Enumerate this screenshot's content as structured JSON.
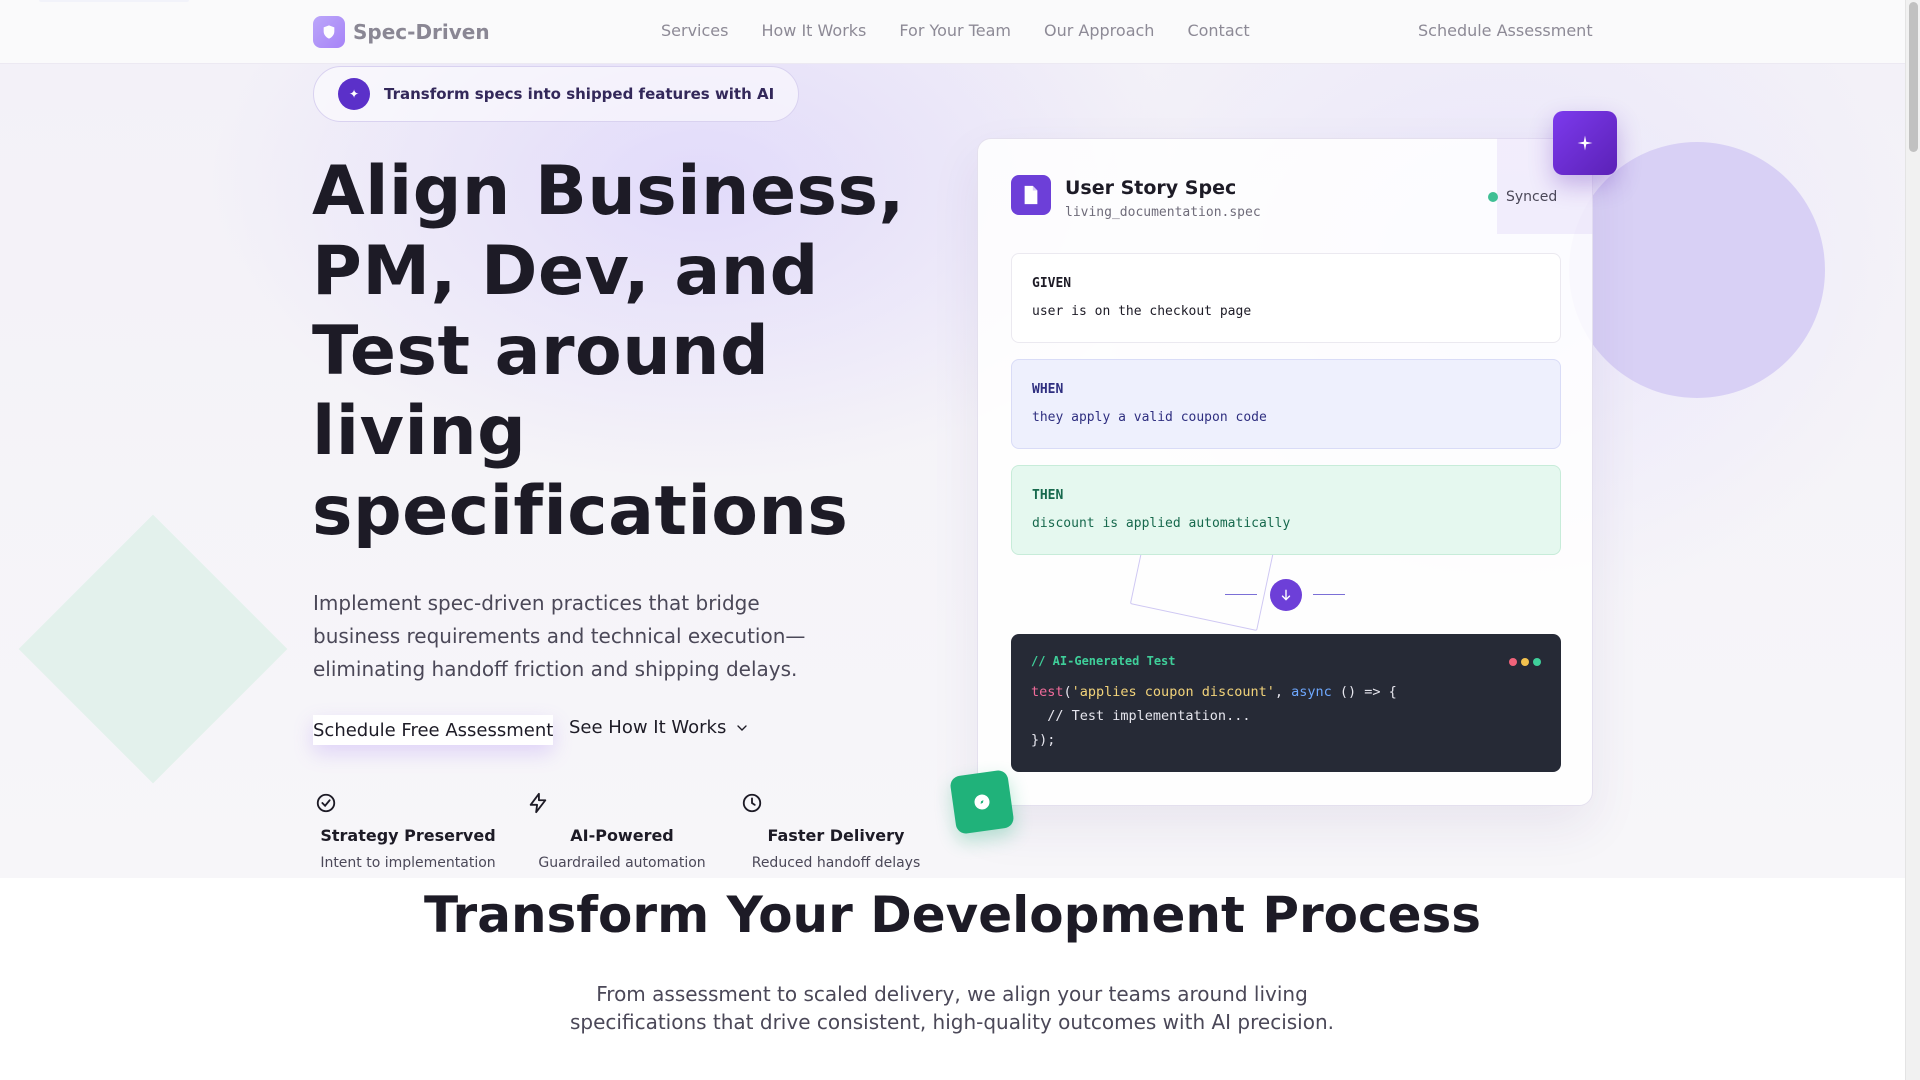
{
  "header": {
    "brand": "Spec-Driven",
    "nav": [
      "Services",
      "How It Works",
      "For Your Team",
      "Our Approach",
      "Contact"
    ],
    "cta": "Schedule Assessment"
  },
  "hero": {
    "badge": "Transform specs into shipped features with AI",
    "title": "Align Business, PM, Dev, and Test around living specifications",
    "subtitle": "Implement spec-driven practices that bridge business requirements and technical execution—eliminating handoff friction and shipping delays.",
    "primary_cta": "Schedule Free Assessment",
    "secondary_cta": "See How It Works",
    "features": [
      {
        "icon": "check-circle-icon",
        "title": "Strategy Preserved",
        "subtitle": "Intent to implementation"
      },
      {
        "icon": "lightning-icon",
        "title": "AI-Powered",
        "subtitle": "Guardrailed automation"
      },
      {
        "icon": "clock-icon",
        "title": "Faster Delivery",
        "subtitle": "Reduced handoff delays"
      }
    ]
  },
  "spec_card": {
    "title": "User Story Spec",
    "file": "living_documentation.spec",
    "status": "Synced",
    "given": {
      "label": "GIVEN",
      "text": "user is on the checkout page"
    },
    "when": {
      "label": "WHEN",
      "text": "they apply a valid coupon code"
    },
    "then": {
      "label": "THEN",
      "text": "discount is applied automatically"
    },
    "code": {
      "header": "// AI-Generated Test",
      "fn": "test",
      "str": "'applies coupon discount'",
      "kw": "async",
      "line1_rest": " () => {",
      "line2": "  // Test implementation...",
      "line3": "});"
    }
  },
  "section2": {
    "title": "Transform Your Development Process",
    "subtitle": "From assessment to scaled delivery, we align your teams around living specifications that drive consistent, high-quality outcomes with AI precision."
  },
  "colors": {
    "accent": "#6d3fd8",
    "success": "#20b27a",
    "code_bg": "#262a36"
  }
}
